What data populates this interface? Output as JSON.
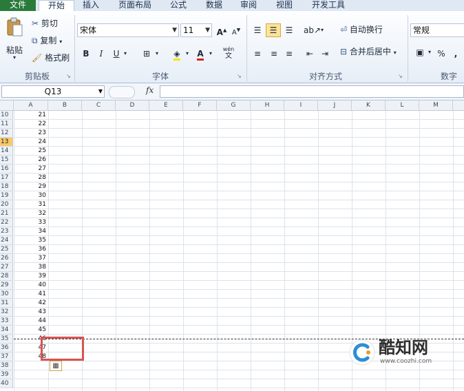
{
  "tabs": {
    "file": "文件",
    "home": "开始",
    "insert": "插入",
    "layout": "页面布局",
    "formulas": "公式",
    "data": "数据",
    "review": "审阅",
    "view": "视图",
    "developer": "开发工具"
  },
  "clipboard": {
    "paste": "粘贴",
    "cut": "剪切",
    "copy": "复制",
    "format_painter": "格式刷",
    "group_label": "剪贴板"
  },
  "font": {
    "name": "宋体",
    "size": "11",
    "bold": "B",
    "italic": "I",
    "underline": "U",
    "group_label": "字体",
    "phonetic": "wén"
  },
  "alignment": {
    "wrap_text": "自动换行",
    "merge_center": "合并后居中",
    "group_label": "对齐方式"
  },
  "number": {
    "format": "常规",
    "percent": "%",
    "comma": ",",
    "group_label": "数字"
  },
  "formula_bar": {
    "name_box": "Q13",
    "fx": "fx"
  },
  "columns": [
    "A",
    "B",
    "C",
    "D",
    "E",
    "F",
    "G",
    "H",
    "I",
    "J",
    "K",
    "L",
    "M"
  ],
  "rows": [
    {
      "n": "10",
      "v": "21"
    },
    {
      "n": "11",
      "v": "22"
    },
    {
      "n": "12",
      "v": "23"
    },
    {
      "n": "13",
      "v": "24"
    },
    {
      "n": "14",
      "v": "25"
    },
    {
      "n": "15",
      "v": "26"
    },
    {
      "n": "16",
      "v": "27"
    },
    {
      "n": "17",
      "v": "28"
    },
    {
      "n": "18",
      "v": "29"
    },
    {
      "n": "19",
      "v": "30"
    },
    {
      "n": "20",
      "v": "31"
    },
    {
      "n": "21",
      "v": "32"
    },
    {
      "n": "22",
      "v": "33"
    },
    {
      "n": "23",
      "v": "34"
    },
    {
      "n": "24",
      "v": "35"
    },
    {
      "n": "25",
      "v": "36"
    },
    {
      "n": "26",
      "v": "37"
    },
    {
      "n": "27",
      "v": "38"
    },
    {
      "n": "28",
      "v": "39"
    },
    {
      "n": "29",
      "v": "40"
    },
    {
      "n": "30",
      "v": "41"
    },
    {
      "n": "31",
      "v": "42"
    },
    {
      "n": "32",
      "v": "43"
    },
    {
      "n": "33",
      "v": "44"
    },
    {
      "n": "34",
      "v": "45"
    },
    {
      "n": "35",
      "v": "46"
    },
    {
      "n": "36",
      "v": "47"
    },
    {
      "n": "37",
      "v": "48"
    },
    {
      "n": "38",
      "v": ""
    },
    {
      "n": "39",
      "v": ""
    },
    {
      "n": "40",
      "v": ""
    }
  ],
  "selected_row": "13",
  "watermark": {
    "name": "酷知网",
    "url": "www.coozhi.com"
  },
  "colors": {
    "file_tab": "#2a7a3a",
    "highlight_box": "#d9534f",
    "selected_row_header": "#f7c96a"
  }
}
